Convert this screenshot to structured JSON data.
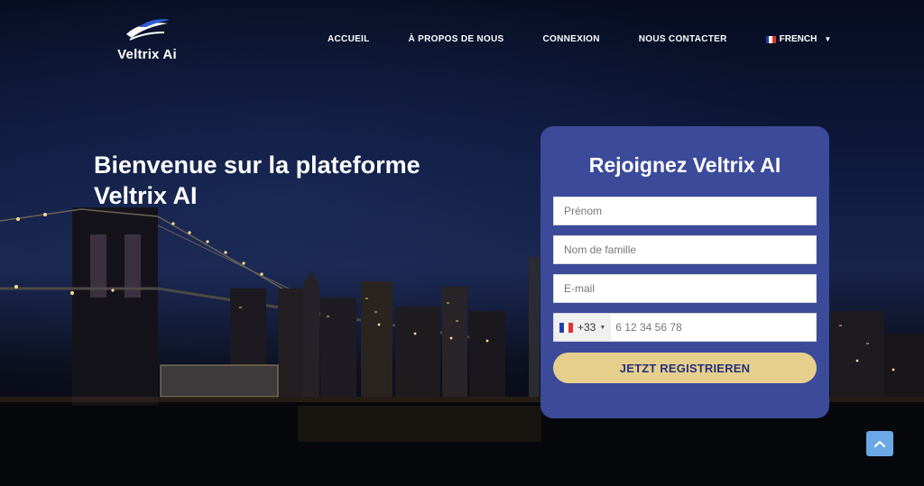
{
  "brand": {
    "name": "Veltrix Ai"
  },
  "nav": {
    "items": [
      {
        "label": "ACCUEIL"
      },
      {
        "label": "À PROPOS DE NOUS"
      },
      {
        "label": "CONNEXION"
      },
      {
        "label": "NOUS CONTACTER"
      }
    ],
    "language": "FRENCH"
  },
  "hero": {
    "title_line1": "Bienvenue sur la plateforme",
    "title_line2": "Veltrix AI"
  },
  "form": {
    "title": "Rejoignez Veltrix AI",
    "first_name_placeholder": "Prénom",
    "last_name_placeholder": "Nom de famille",
    "email_placeholder": "E-mail",
    "country_code": "+33",
    "phone_placeholder": "6 12 34 56 78",
    "submit_label": "JETZT REGISTRIEREN"
  },
  "colors": {
    "card": "#3c4a9a",
    "button": "#e6cf8d",
    "button_text": "#23307a",
    "scroll_top": "#6aa8e6"
  },
  "icons": {
    "logo": "swoosh-logo-icon",
    "language_flag": "france-flag-icon",
    "dropdown": "caret-down-icon",
    "scroll_top": "chevron-up-icon"
  }
}
